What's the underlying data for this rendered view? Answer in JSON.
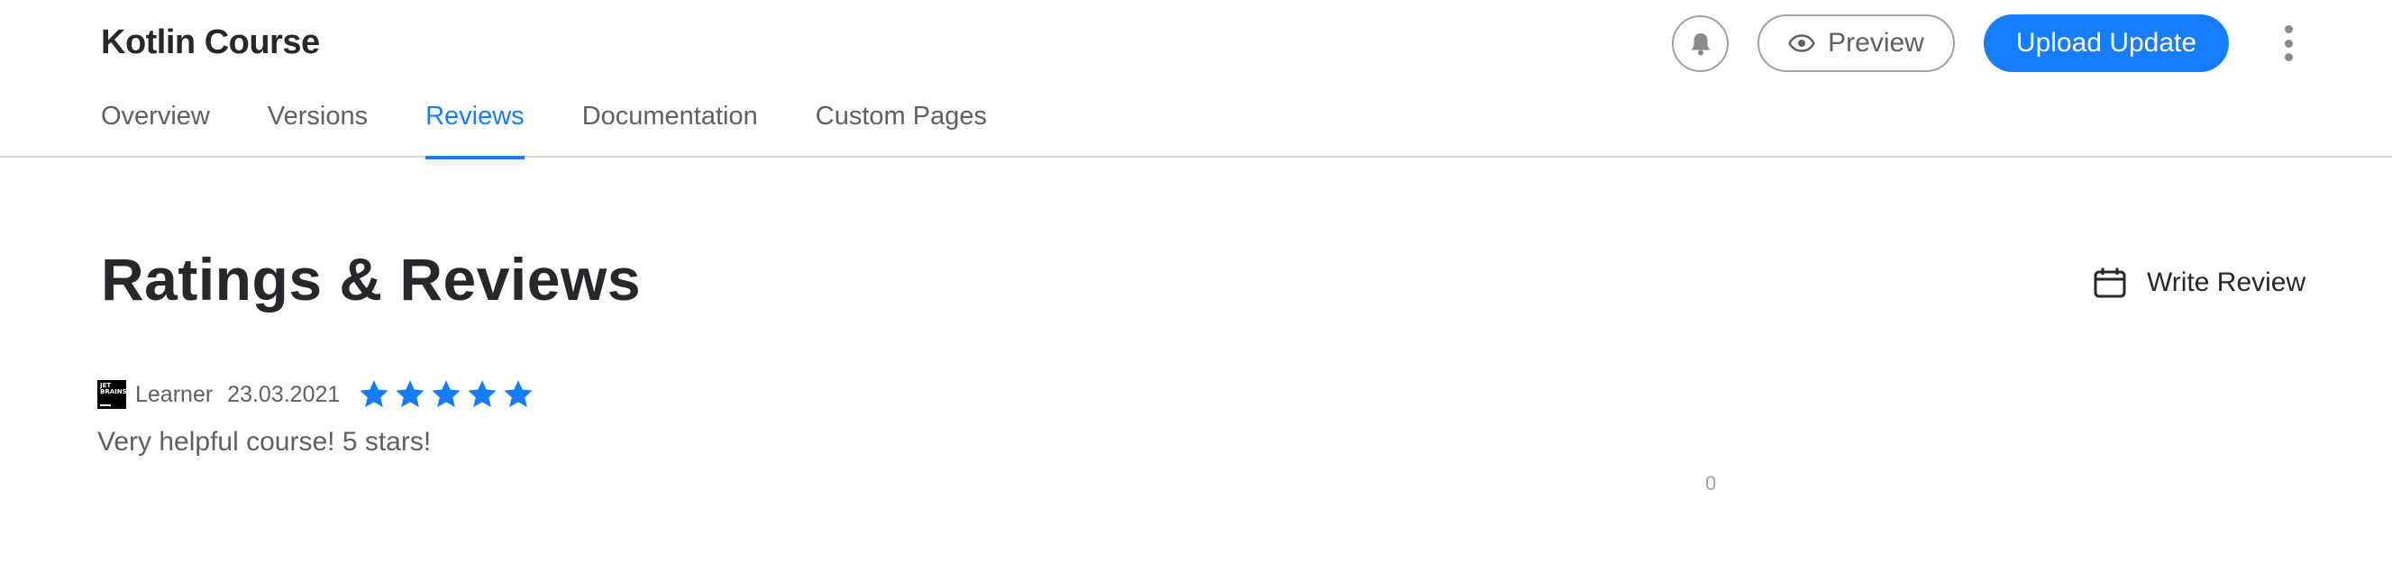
{
  "header": {
    "course_title": "Kotlin Course",
    "tabs": [
      {
        "label": "Overview",
        "active": false
      },
      {
        "label": "Versions",
        "active": false
      },
      {
        "label": "Reviews",
        "active": true
      },
      {
        "label": "Documentation",
        "active": false
      },
      {
        "label": "Custom Pages",
        "active": false
      }
    ],
    "bell_icon": "bell-icon",
    "preview_label": "Preview",
    "preview_icon": "eye-icon",
    "upload_label": "Upload Update",
    "more_icon": "vertical-dots-icon"
  },
  "main": {
    "section_title": "Ratings & Reviews",
    "write_review_label": "Write Review",
    "write_review_icon": "calendar-icon",
    "reviews": [
      {
        "author": "Learner",
        "date": "23.03.2021",
        "rating": 5,
        "text": "Very helpful course! 5 stars!",
        "avatar_text": "JET BRAINS"
      }
    ],
    "counter": "0"
  },
  "colors": {
    "accent": "#167dff",
    "text_primary": "#27282c",
    "text_secondary": "#5f6064",
    "border": "#d3d3d6"
  }
}
